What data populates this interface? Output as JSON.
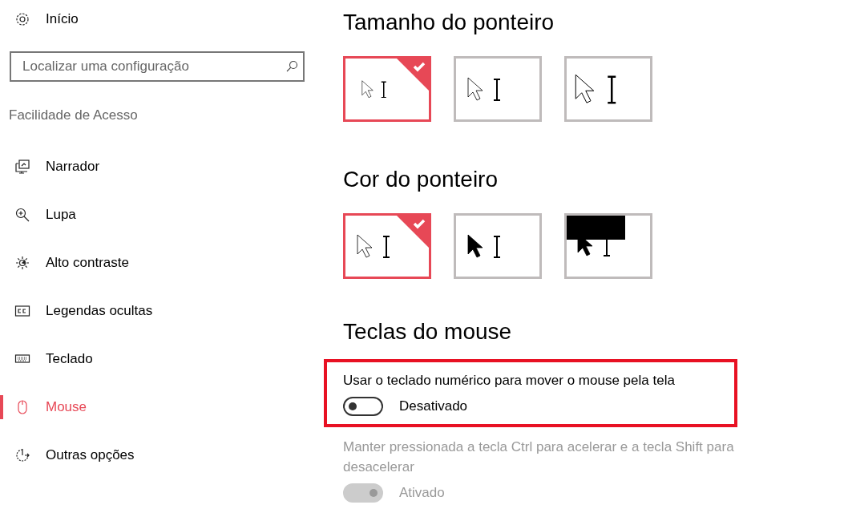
{
  "sidebar": {
    "home": {
      "label": "Início",
      "kind": "gear"
    },
    "search": {
      "placeholder": "Localizar uma configuração"
    },
    "section": "Facilidade de Acesso",
    "items": [
      {
        "label": "Narrador",
        "kind": "narrator",
        "selected": false
      },
      {
        "label": "Lupa",
        "kind": "magnifier",
        "selected": false
      },
      {
        "label": "Alto contraste",
        "kind": "contrast",
        "selected": false
      },
      {
        "label": "Legendas ocultas",
        "kind": "captions",
        "selected": false
      },
      {
        "label": "Teclado",
        "kind": "keyboard",
        "selected": false
      },
      {
        "label": "Mouse",
        "kind": "mouse",
        "selected": true
      },
      {
        "label": "Outras opções",
        "kind": "other",
        "selected": false
      }
    ]
  },
  "pointer_size": {
    "title": "Tamanho do ponteiro",
    "options": [
      {
        "kind": "small",
        "selected": true
      },
      {
        "kind": "medium",
        "selected": false
      },
      {
        "kind": "large",
        "selected": false
      }
    ]
  },
  "pointer_color": {
    "title": "Cor do ponteiro",
    "options": [
      {
        "kind": "white",
        "selected": true
      },
      {
        "kind": "black",
        "selected": false
      },
      {
        "kind": "inverted",
        "selected": false
      }
    ]
  },
  "mouse_keys": {
    "title": "Teclas do mouse",
    "settings": [
      {
        "label": "Usar o teclado numérico para mover o mouse pela tela",
        "on": false,
        "state": "Desativado",
        "disabled": false,
        "highlighted": true
      },
      {
        "label": "Manter pressionada a tecla Ctrl para acelerar e a tecla Shift para desacelerar",
        "on": true,
        "state": "Ativado",
        "disabled": true,
        "highlighted": false
      }
    ]
  }
}
